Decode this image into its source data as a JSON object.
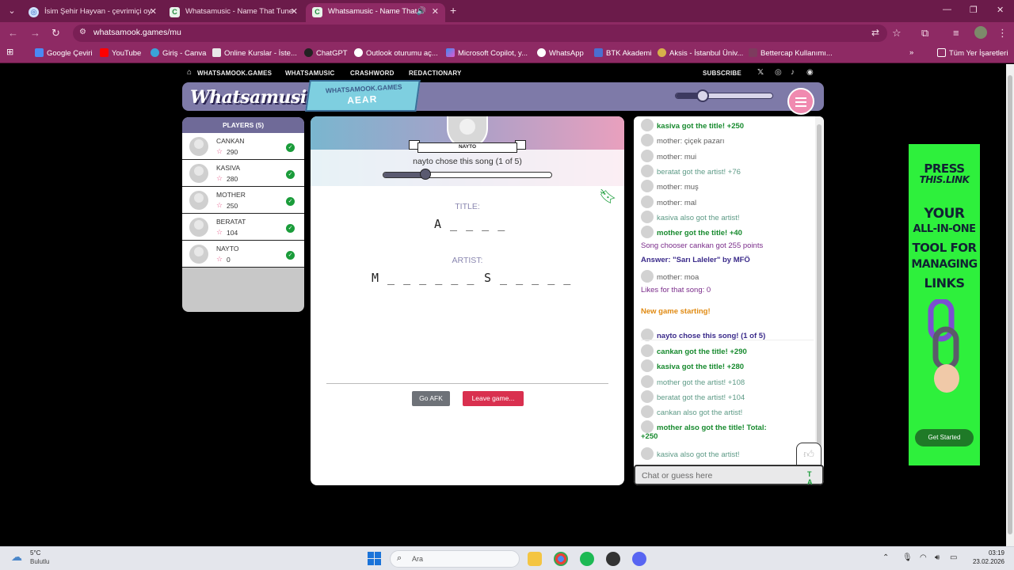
{
  "browser": {
    "tabs": [
      {
        "title": "İsim Şehir Hayvan - çevrimiçi oy",
        "active": false
      },
      {
        "title": "Whatsamusic - Name That Tune",
        "active": false
      },
      {
        "title": "Whatsamusic - Name That",
        "active": true
      }
    ],
    "url": "whatsamook.games/mu",
    "bookmarks": [
      "Google Çeviri",
      "YouTube",
      "Giriş - Canva",
      "Online Kurslar - İste...",
      "ChatGPT",
      "Outlook oturumu aç...",
      "Microsoft Copilot, y...",
      "WhatsApp",
      "BTK Akademi",
      "Aksis - İstanbul Üniv...",
      "Bettercap Kullanımı...",
      "Tüm Yer İşaretleri"
    ]
  },
  "site_nav": {
    "items": [
      "WHATSAMOOK.GAMES",
      "WHATSAMUSIC",
      "CRASHWORD",
      "REDACTIONARY"
    ],
    "subscribe": "SUBSCRIBE"
  },
  "header": {
    "logo": "Whatsamusic",
    "badge_domain": "WHATSAMOOK.GAMES",
    "room_code": "AEAR",
    "volume": 0.28
  },
  "players": {
    "heading": "PLAYERS (5)",
    "list": [
      {
        "name": "CANKAN",
        "score": "290"
      },
      {
        "name": "KASIVA",
        "score": "280"
      },
      {
        "name": "MOTHER",
        "score": "250"
      },
      {
        "name": "BERATAT",
        "score": "104"
      },
      {
        "name": "NAYTO",
        "score": "0"
      }
    ]
  },
  "game": {
    "chooser_name": "NAYTO",
    "chose_text": "nayto chose this song (1 of 5)",
    "timer_progress": 0.25,
    "title_label": "TITLE:",
    "title_blanks": "A _ _ _ _",
    "artist_label": "ARTIST:",
    "artist_blanks_1": "M _ _ _ _ _ _",
    "artist_blanks_2": "S _ _ _ _ _",
    "afk_button": "Go AFK",
    "leave_button": "Leave game..."
  },
  "chat": {
    "messages": [
      {
        "text": "kasiva got the title! +250",
        "style": "green",
        "avatar": true
      },
      {
        "text": "mother: çiçek pazarı",
        "style": "gray",
        "avatar": true
      },
      {
        "text": "mother: mui",
        "style": "gray",
        "avatar": true
      },
      {
        "text": "beratat got the artist! +76",
        "style": "teal",
        "avatar": true
      },
      {
        "text": "mother: muş",
        "style": "gray",
        "avatar": true
      },
      {
        "text": "mother: mal",
        "style": "gray",
        "avatar": true
      },
      {
        "text": "kasiva also got the artist!",
        "style": "teal",
        "avatar": true
      },
      {
        "text": "mother got the title! +40",
        "style": "green",
        "avatar": true
      },
      {
        "text": "Song chooser cankan got 255 points",
        "style": "purple",
        "avatar": false
      },
      {
        "text": "Answer: \"Sarı Laleler\" by MFÖ",
        "style": "dpurple",
        "avatar": false
      },
      {
        "text": "mother: moa",
        "style": "gray",
        "avatar": true
      },
      {
        "text": "Likes for that song: 0",
        "style": "purple",
        "avatar": false
      },
      {
        "text": "New game starting!",
        "style": "orange",
        "avatar": false
      },
      {
        "text": "nayto chose this song! (1 of 5)",
        "style": "dpurple",
        "avatar": true
      },
      {
        "text": "cankan got the title! +290",
        "style": "green",
        "avatar": true
      },
      {
        "text": "kasiva got the title! +280",
        "style": "green",
        "avatar": true
      },
      {
        "text": "mother got the artist! +108",
        "style": "teal",
        "avatar": true
      },
      {
        "text": "beratat got the artist! +104",
        "style": "teal",
        "avatar": true
      },
      {
        "text": "cankan also got the artist!",
        "style": "teal",
        "avatar": true
      },
      {
        "text": "mother also got the title! Total:",
        "style": "green",
        "avatar": true
      },
      {
        "text": "+250",
        "style": "green",
        "avatar": false
      },
      {
        "text": "kasiva also got the artist!",
        "style": "teal",
        "avatar": true
      }
    ],
    "input_placeholder": "Chat or guess here",
    "input_suffix": "T A"
  },
  "ad": {
    "lines": [
      "PRESS",
      "THIS.LINK",
      "YOUR",
      "ALL-IN-ONE",
      "TOOL FOR",
      "MANAGING",
      "LINKS"
    ],
    "cta": "Get Started"
  },
  "taskbar": {
    "temperature": "5°C",
    "condition": "Bulutlu",
    "search": "Ara",
    "time": "03:19",
    "date": "23.02.2026"
  }
}
